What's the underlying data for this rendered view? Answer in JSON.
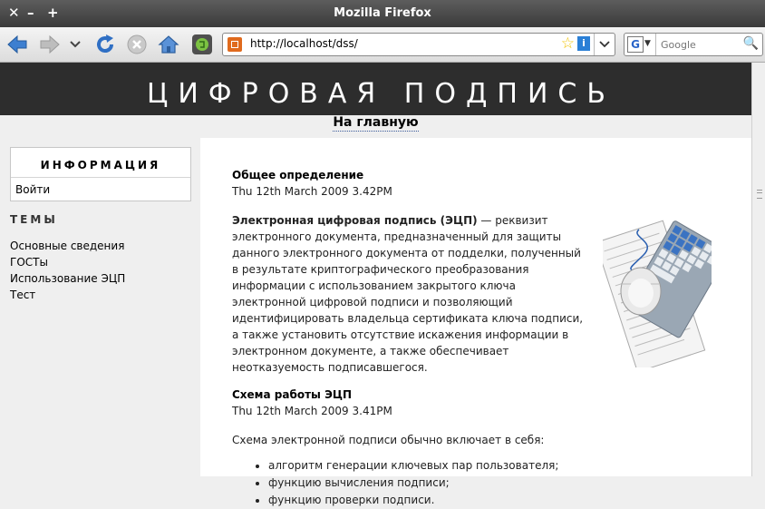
{
  "window": {
    "title": "Mozilla Firefox",
    "controls": {
      "close": "✕",
      "minimize": "–",
      "maximize": "+"
    }
  },
  "toolbar": {
    "url": "http://localhost/dss/",
    "search_placeholder": "Google"
  },
  "site": {
    "title": "ЦИФРОВАЯ ПОДПИСЬ",
    "home_link": "На главную"
  },
  "sidebar": {
    "info_heading": "ИНФОРМАЦИЯ",
    "login": "Войти",
    "themes_heading": "ТЕМЫ",
    "themes": [
      "Основные сведения",
      "ГОСТы",
      "Использование ЭЦП",
      "Тест"
    ]
  },
  "articles": [
    {
      "title": "Общее определение",
      "date": "Thu 12th March 2009 3.42PM",
      "term": "Электронная цифровая подпись (ЭЦП)",
      "body": " — реквизит электронного документа, предназначенный для защиты данного электронного документа от подделки, полученный в результате криптографического преобразования информации с использованием закрытого ключа электронной цифровой подписи и позволяющий идентифицировать владельца сертификата ключа подписи, а также установить отсутствие искажения информации в электронном документе, а также обеспечивает неотказуемость подписавшегося."
    },
    {
      "title": "Схема работы ЭЦП",
      "date": "Thu 12th March 2009 3.41PM",
      "intro": "Схема электронной подписи обычно включает в себя:",
      "items": [
        "алгоритм генерации ключевых пар пользователя;",
        "функцию вычисления подписи;",
        "функцию проверки подписи."
      ]
    }
  ]
}
